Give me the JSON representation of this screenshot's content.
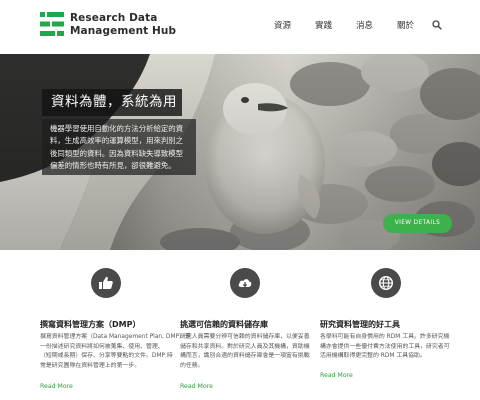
{
  "brand": {
    "line1": "Research Data",
    "line2": "Management Hub",
    "color": "#20a84a"
  },
  "nav": {
    "items": [
      "資源",
      "實踐",
      "消息",
      "關於"
    ],
    "search_icon": "search-icon"
  },
  "hero": {
    "title": "資料為體，系統為用",
    "description_lines": [
      "機器學習使用自動化的方法分析給定的資",
      "料，生成高效率的運算模型，用來判別之",
      "後同類型的資料。因為資料缺失導致模型",
      "偏差的情形也時有所見，卻很難避免。"
    ],
    "button": "VIEW DETAILS",
    "accent": "#3db14b"
  },
  "features": [
    {
      "icon": "thumbs-up-icon",
      "title": "撰寫資料管理方案（DMP）",
      "lines": [
        "撰寫資料管理方案（Data Management Plan, DMP）是",
        "一份描述研究資料將如何被蒐集、使用、管理、",
        "（短期或長期）保存、分享等要點的文件。DMP 時",
        "常是研究團隊在資料管理上的第一步。"
      ],
      "link": "Read More"
    },
    {
      "icon": "cloud-download-icon",
      "title": "挑選可信賴的資料儲存庫",
      "lines": [
        "研究人員需要分辨可信賴的資料儲存庫，以便妥善",
        "儲存和共享資料。對於研究人員及其機構，資助機",
        "構而言，識別合適的資料儲存庫會是一項富有挑戰",
        "的任務。"
      ],
      "link": "Read More"
    },
    {
      "icon": "globe-icon",
      "title": "研究資料管理的好工具",
      "lines": [
        "各學科可能有自身慣用的 RDM 工具。許多研究機",
        "構亦會提供一些優付費方法使用的工具，研究者可",
        "活用機構取得更完整的 RDM 工具協助。"
      ],
      "link": "Read More"
    }
  ]
}
